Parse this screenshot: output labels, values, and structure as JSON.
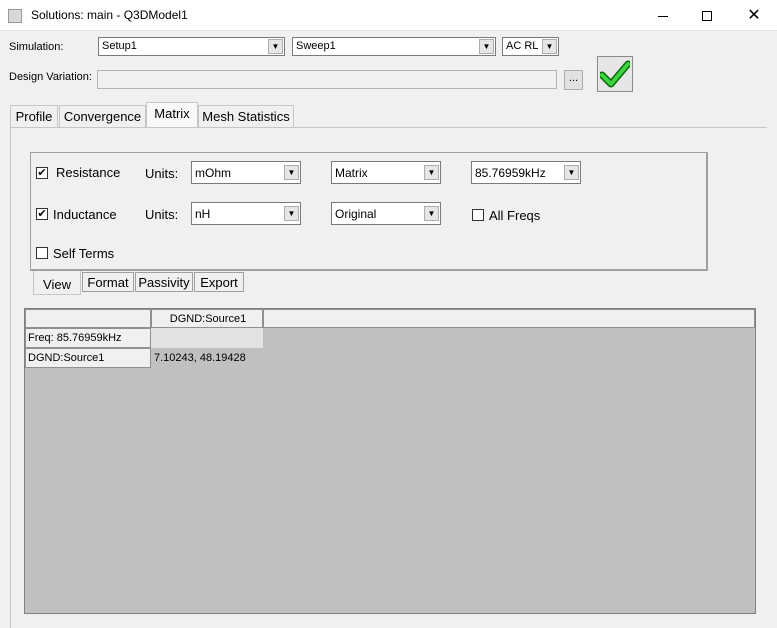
{
  "window": {
    "title": "Solutions: main - Q3DModel1",
    "minimize_icon": "minimize-icon",
    "maximize_icon": "maximize-icon",
    "close_icon": "close-icon"
  },
  "simulation": {
    "label": "Simulation:",
    "setup": "Setup1",
    "sweep": "Sweep1",
    "type": "AC RL"
  },
  "design_variation": {
    "label": "Design Variation:",
    "value": "",
    "browse_label": "..."
  },
  "apply_icon": "green-check-icon",
  "tabs": [
    "Profile",
    "Convergence",
    "Matrix",
    "Mesh Statistics"
  ],
  "active_tab": "Matrix",
  "matrix": {
    "resistance": {
      "label": "Resistance",
      "checked": true,
      "units_label": "Units:",
      "units": "mOhm",
      "display": "Matrix",
      "freq": "85.76959kHz"
    },
    "inductance": {
      "label": "Inductance",
      "checked": true,
      "units_label": "Units:",
      "units": "nH",
      "display": "Original"
    },
    "all_freqs": {
      "label": "All Freqs",
      "checked": false
    },
    "self_terms": {
      "label": "Self Terms",
      "checked": false
    },
    "check_mark": "✔"
  },
  "subtabs": [
    "View",
    "Format",
    "Passivity",
    "Export"
  ],
  "active_subtab": "View",
  "grid": {
    "column_header": "DGND:Source1",
    "freq_row_label": "Freq: 85.76959kHz",
    "row_label": "DGND:Source1",
    "row_value": "7.10243, 48.19428"
  }
}
